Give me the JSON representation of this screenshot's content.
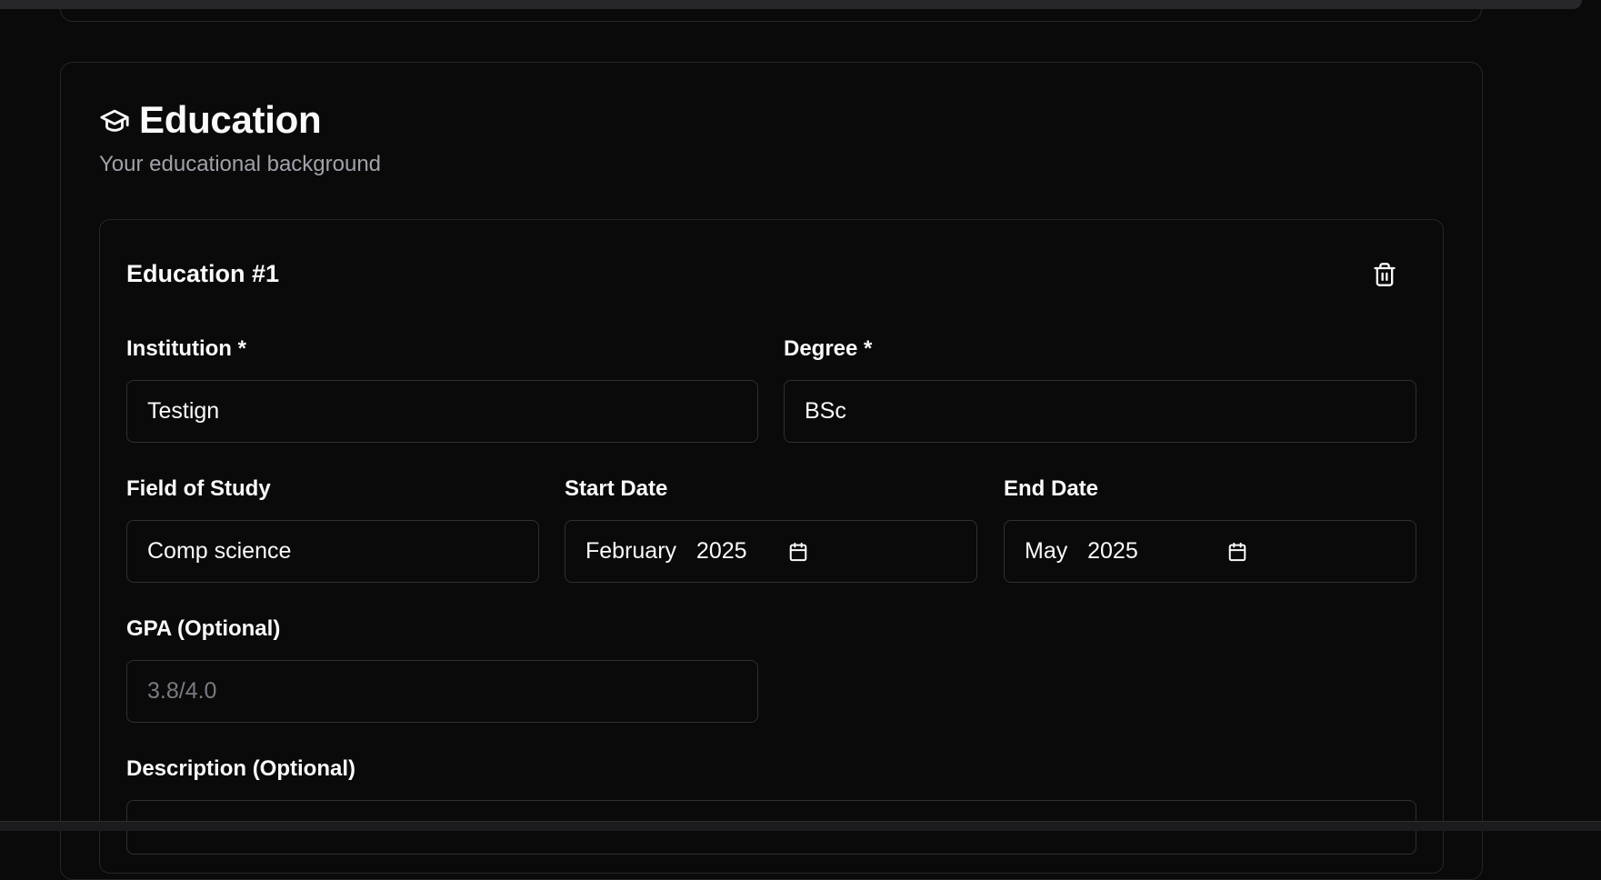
{
  "section": {
    "title": "Education",
    "subtitle": "Your educational background"
  },
  "entry": {
    "title": "Education #1",
    "delete_icon": "trash-icon",
    "fields": {
      "institution": {
        "label": "Institution *",
        "value": "Testign"
      },
      "degree": {
        "label": "Degree *",
        "value": "BSc"
      },
      "field_of_study": {
        "label": "Field of Study",
        "value": "Comp science"
      },
      "start_date": {
        "label": "Start Date",
        "value": "February  2025"
      },
      "end_date": {
        "label": "End Date",
        "value": "May  2025"
      },
      "gpa": {
        "label": "GPA (Optional)",
        "placeholder": "3.8/4.0"
      },
      "description": {
        "label": "Description (Optional)"
      }
    }
  },
  "icons": {
    "section_icon": "graduation-cap-icon",
    "date_icon": "calendar-icon"
  },
  "colors": {
    "background": "#0a0a0a",
    "border": "#303034",
    "text": "#fafafa",
    "muted_text": "#a1a1aa",
    "placeholder": "#7a7a82"
  }
}
